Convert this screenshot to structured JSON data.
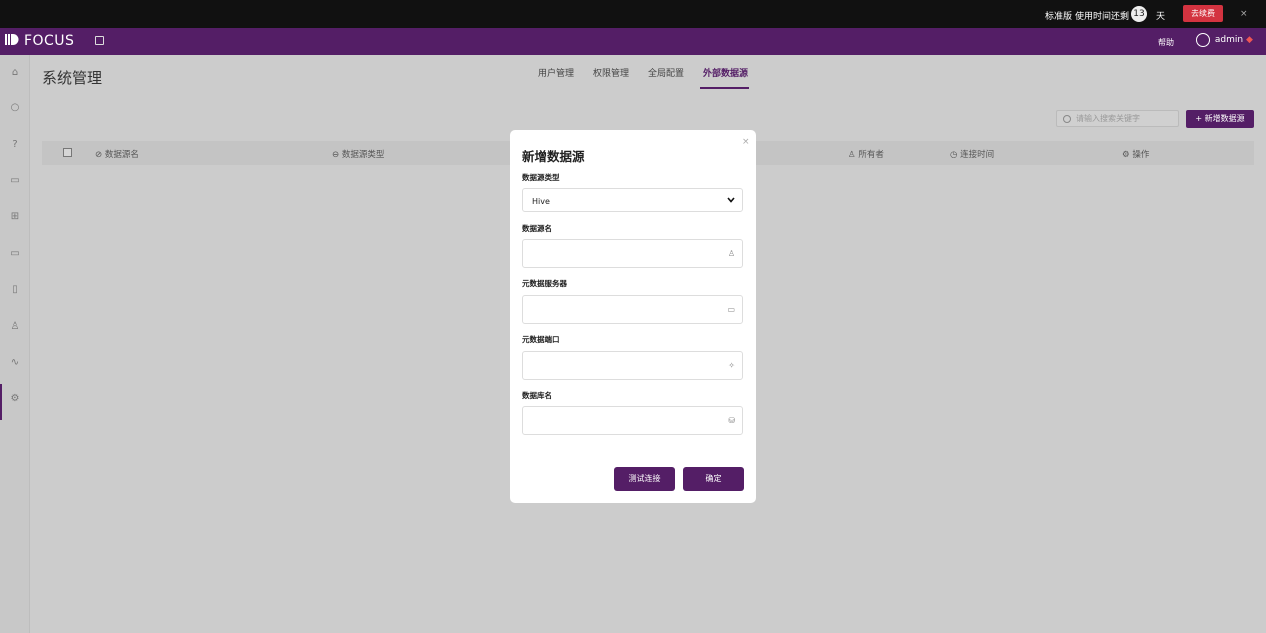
{
  "topbar": {
    "edition": "标准版",
    "remaining_label": "使用时间还剩",
    "days": "13",
    "day_unit": "天",
    "renew_label": "去续费",
    "close": "×"
  },
  "nav": {
    "logo": "FOCUS",
    "help": "帮助",
    "user": "admin"
  },
  "sidebar": {
    "icons": [
      "home-icon",
      "search-icon",
      "help-icon",
      "presentation-icon",
      "table-icon",
      "folder-icon",
      "clipboard-icon",
      "user-icon",
      "pulse-icon",
      "settings-icon"
    ],
    "active": "settings-icon"
  },
  "page": {
    "title": "系统管理"
  },
  "tabs": [
    {
      "label": "用户管理",
      "active": false
    },
    {
      "label": "权限管理",
      "active": false
    },
    {
      "label": "全局配置",
      "active": false
    },
    {
      "label": "外部数据源",
      "active": true
    }
  ],
  "toolbar": {
    "search_placeholder": "请输入搜索关键字",
    "add_label": "+ 新增数据源"
  },
  "table": {
    "columns": [
      "数据源名",
      "数据源类型",
      "所有者",
      "连接时间",
      "操作"
    ]
  },
  "modal": {
    "title": "新增数据源",
    "close": "×",
    "fields": [
      {
        "label": "数据源类型",
        "value": "Hive",
        "icon": "chevron-down-icon"
      },
      {
        "label": "数据源名",
        "value": "",
        "icon": "user-icon"
      },
      {
        "label": "元数据服务器",
        "value": "",
        "icon": "monitor-icon"
      },
      {
        "label": "元数据端口",
        "value": "",
        "icon": "port-icon"
      },
      {
        "label": "数据库名",
        "value": "",
        "icon": "database-icon"
      }
    ],
    "test_label": "测试连接",
    "ok_label": "确定"
  },
  "colors": {
    "brand": "#541e66",
    "danger": "#d33340",
    "topbar": "#111111"
  }
}
